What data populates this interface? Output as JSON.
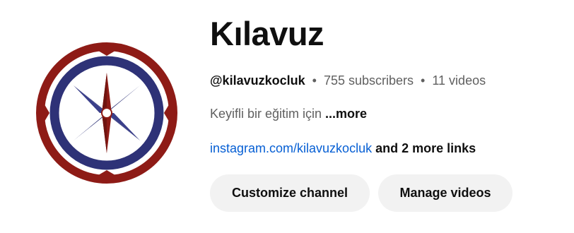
{
  "channel": {
    "name": "Kılavuz",
    "handle": "@kilavuzkocluk",
    "subscribers": "755 subscribers",
    "videos": "11 videos",
    "separator": "•",
    "description": "Keyifli bir eğitim için ",
    "more_label": "...more",
    "link_text": "instagram.com/kilavuzkocluk",
    "more_links": " and 2 more links",
    "avatar_icon": "compass-rose-icon"
  },
  "actions": {
    "customize_label": "Customize channel",
    "manage_label": "Manage videos"
  },
  "colors": {
    "outer_ring": "#8e1b16",
    "inner_ring": "#2e3277",
    "star_blue": "#2e3277",
    "star_red": "#8e1b16"
  }
}
